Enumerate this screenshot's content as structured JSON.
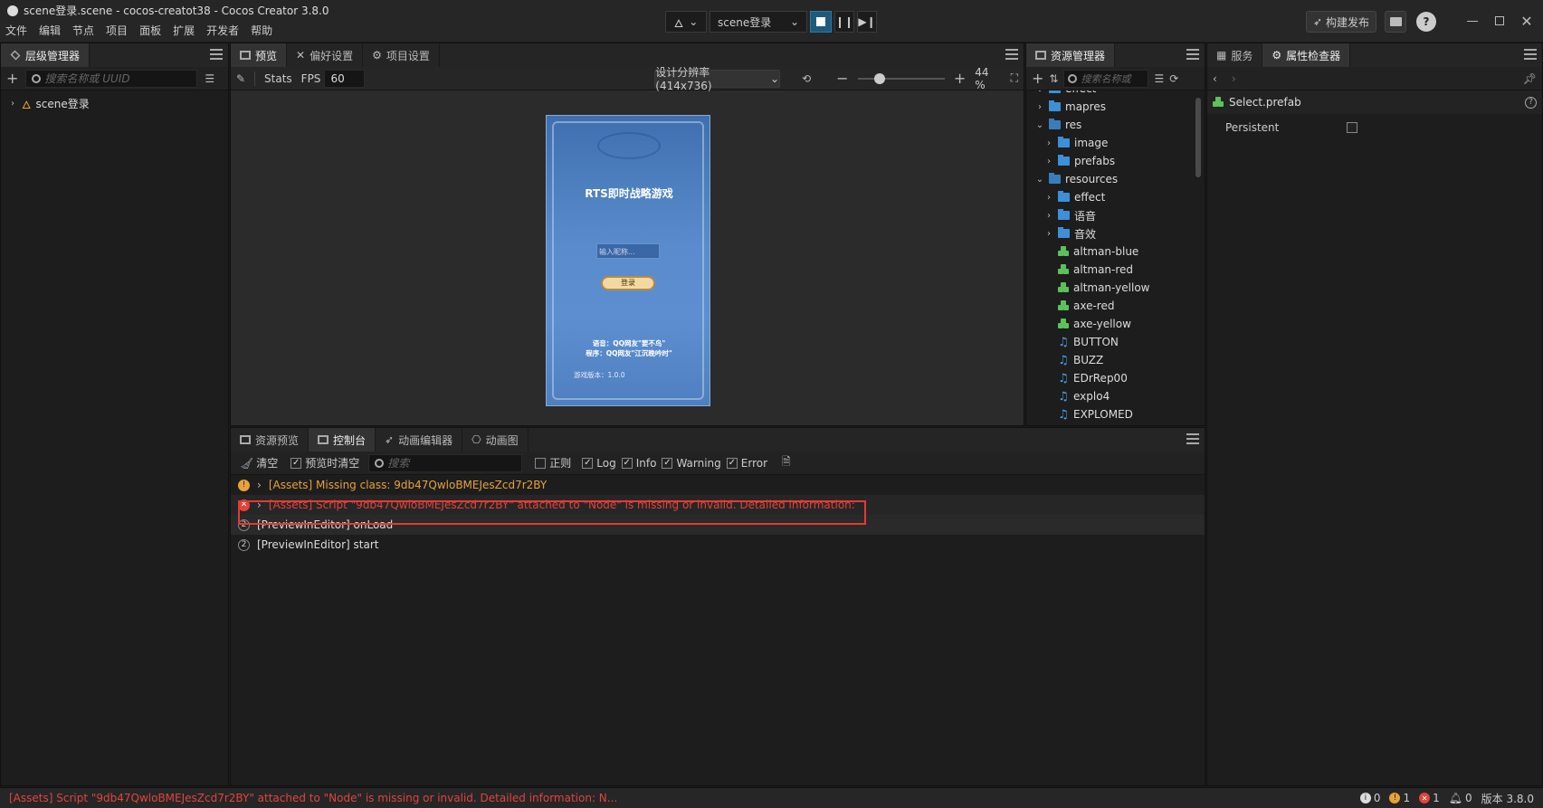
{
  "window": {
    "title": "scene登录.scene - cocos-creatot38 - Cocos Creator 3.8.0"
  },
  "menu": [
    "文件",
    "编辑",
    "节点",
    "项目",
    "面板",
    "扩展",
    "开发者",
    "帮助"
  ],
  "run_controls": {
    "platform_icon": "flame-icon",
    "scene_select": "scene登录"
  },
  "top_right": {
    "build_label": "构建发布"
  },
  "hierarchy": {
    "tab": "层级管理器",
    "search_placeholder": "搜索名称或 UUID",
    "root_item": "scene登录"
  },
  "center_tabs": [
    "预览",
    "偏好设置",
    "项目设置"
  ],
  "preview_toolbar": {
    "stats": "Stats",
    "fps_label": "FPS",
    "fps_value": "60",
    "resolution": "设计分辨率 (414x736)",
    "zoom": "44 %",
    "zoom_fraction": 0.25
  },
  "game_preview": {
    "title": "RTS即时战略游戏",
    "input_placeholder": "输入昵称...",
    "login_button": "登录",
    "credit_voice": "语音：QQ网友\"要不鸟\"",
    "credit_program": "程序：QQ网友\"江沉晚吟时\"",
    "version": "游戏版本：1.0.0"
  },
  "assets": {
    "tab": "资源管理器",
    "search_placeholder": "搜索名称或",
    "items": [
      {
        "label": "effect",
        "type": "folder",
        "depth": 1,
        "chevron": "down"
      },
      {
        "label": "mapres",
        "type": "folder",
        "depth": 1,
        "chevron": "right"
      },
      {
        "label": "res",
        "type": "folder-open",
        "depth": 1,
        "chevron": "down"
      },
      {
        "label": "image",
        "type": "folder",
        "depth": 2,
        "chevron": "right"
      },
      {
        "label": "prefabs",
        "type": "folder",
        "depth": 2,
        "chevron": "right"
      },
      {
        "label": "resources",
        "type": "folder-open",
        "depth": 1,
        "chevron": "down"
      },
      {
        "label": "effect",
        "type": "folder",
        "depth": 2,
        "chevron": "right"
      },
      {
        "label": "语音",
        "type": "folder",
        "depth": 2,
        "chevron": "right"
      },
      {
        "label": "音效",
        "type": "folder",
        "depth": 2,
        "chevron": "right"
      },
      {
        "label": "altman-blue",
        "type": "prefab",
        "depth": 2,
        "chevron": ""
      },
      {
        "label": "altman-red",
        "type": "prefab",
        "depth": 2,
        "chevron": ""
      },
      {
        "label": "altman-yellow",
        "type": "prefab",
        "depth": 2,
        "chevron": ""
      },
      {
        "label": "axe-red",
        "type": "prefab",
        "depth": 2,
        "chevron": ""
      },
      {
        "label": "axe-yellow",
        "type": "prefab",
        "depth": 2,
        "chevron": ""
      },
      {
        "label": "BUTTON",
        "type": "audio",
        "depth": 2,
        "chevron": ""
      },
      {
        "label": "BUZZ",
        "type": "audio",
        "depth": 2,
        "chevron": ""
      },
      {
        "label": "EDrRep00",
        "type": "audio",
        "depth": 2,
        "chevron": ""
      },
      {
        "label": "explo4",
        "type": "audio",
        "depth": 2,
        "chevron": ""
      },
      {
        "label": "EXPLOMED",
        "type": "audio",
        "depth": 2,
        "chevron": ""
      }
    ]
  },
  "inspector": {
    "tabs": [
      "服务",
      "属性检查器"
    ],
    "asset_name": "Select.prefab",
    "prop_label": "Persistent",
    "persistent_checked": false
  },
  "bottom_tabs": [
    "资源预览",
    "控制台",
    "动画编辑器",
    "动画图"
  ],
  "console_toolbar": {
    "clear": "清空",
    "clear_on_preview": "预览时清空",
    "search_placeholder": "搜索",
    "regex": "正则",
    "log": "Log",
    "info": "Info",
    "warning": "Warning",
    "error": "Error"
  },
  "console_logs": [
    {
      "level": "warning",
      "text": "[Assets] Missing class: 9db47QwloBMEJesZcd7r2BY",
      "color": "#e8a23a"
    },
    {
      "level": "error",
      "text": "[Assets] Script \"9db47QwloBMEJesZcd7r2BY\" attached to \"Node\" is missing or invalid. Detailed information:",
      "color": "#e0443e"
    },
    {
      "level": "log",
      "count": "2",
      "text": "[PreviewInEditor] onLoad"
    },
    {
      "level": "log",
      "count": "2",
      "text": "[PreviewInEditor] start"
    }
  ],
  "status_bar": {
    "message": "[Assets] Script \"9db47QwloBMEJesZcd7r2BY\" attached to \"Node\" is missing or invalid. Detailed information: N...",
    "info_count": "0",
    "warn_count": "1",
    "error_count": "1",
    "notify_count": "0",
    "version": "版本 3.8.0"
  }
}
